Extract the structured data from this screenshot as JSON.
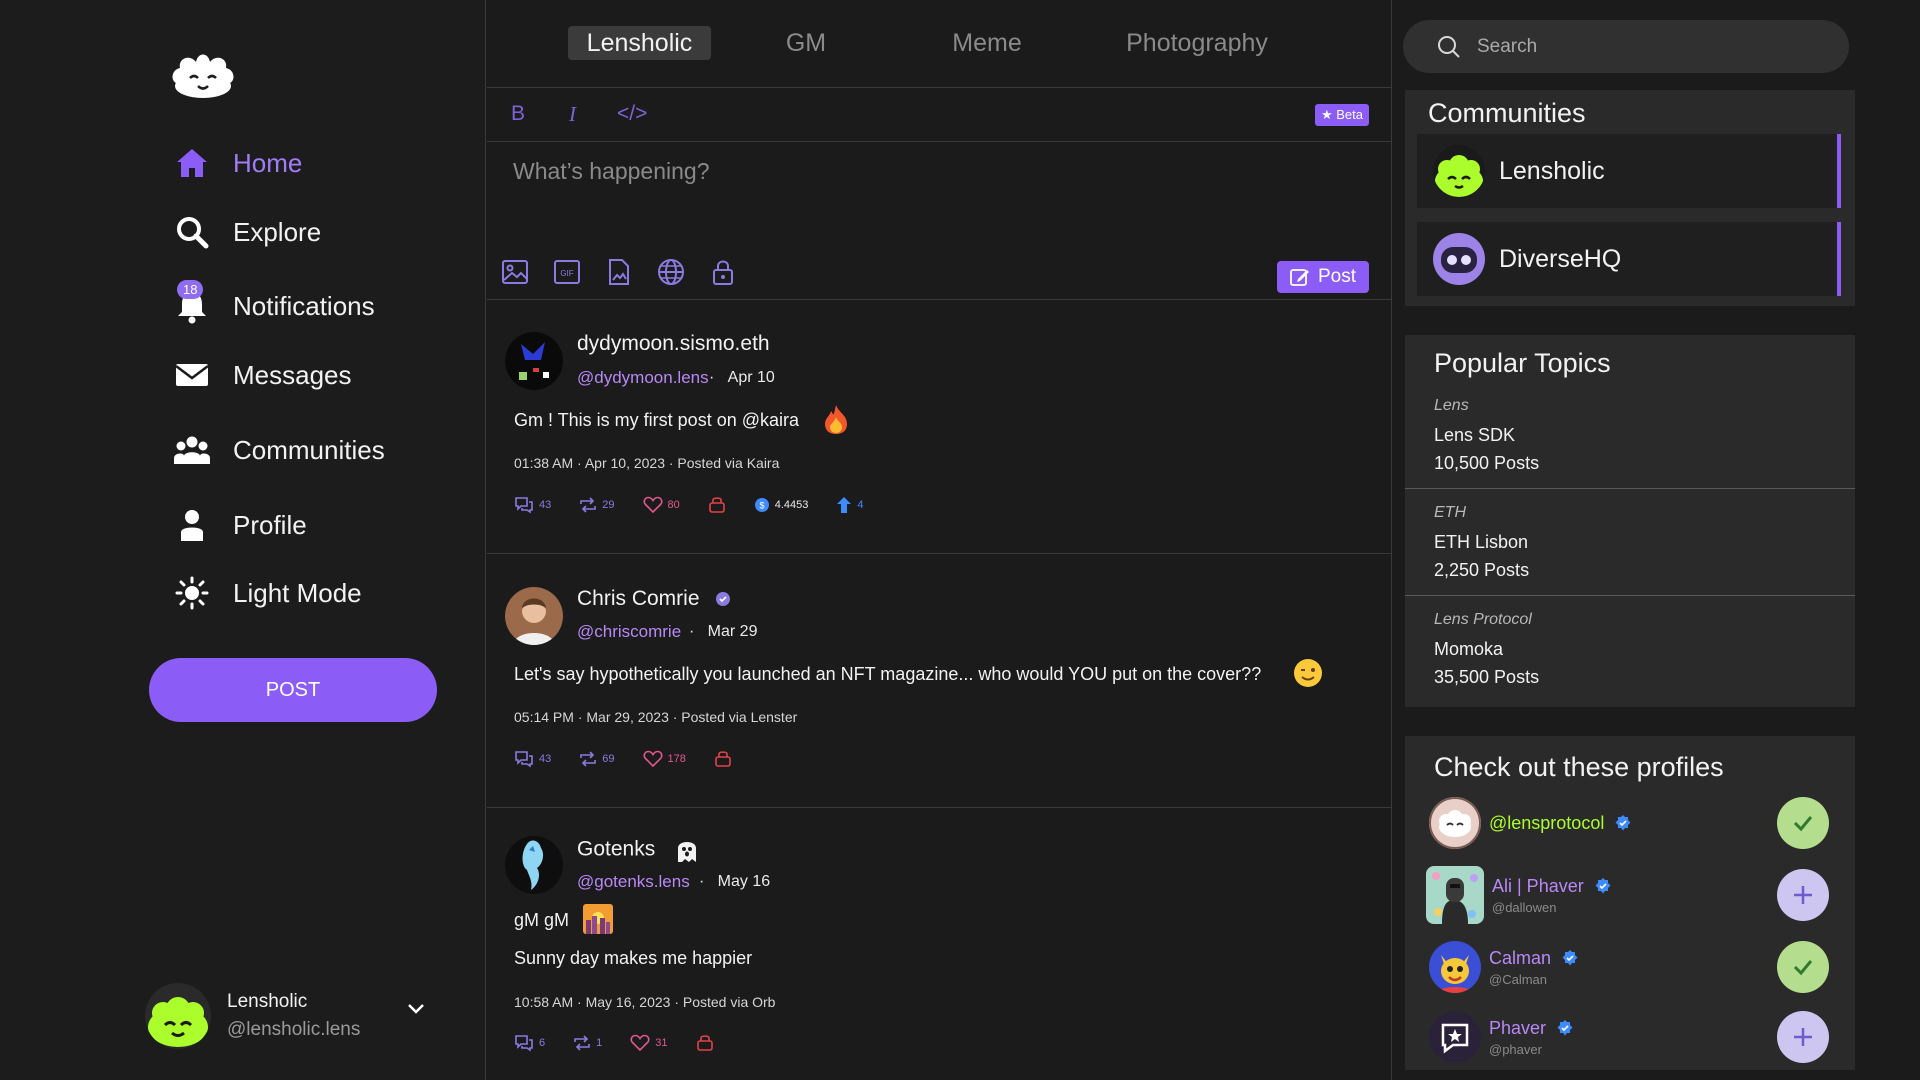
{
  "sidebar": {
    "items": [
      {
        "label": "Home",
        "icon": "home-icon"
      },
      {
        "label": "Explore",
        "icon": "search-icon"
      },
      {
        "label": "Notifications",
        "icon": "bell-icon",
        "badge": "18"
      },
      {
        "label": "Messages",
        "icon": "mail-icon"
      },
      {
        "label": "Communities",
        "icon": "people-icon"
      },
      {
        "label": "Profile",
        "icon": "user-icon"
      },
      {
        "label": "Light Mode",
        "icon": "sun-icon"
      }
    ],
    "post_button": "POST",
    "user": {
      "name": "Lensholic",
      "handle": "@lensholic.lens"
    }
  },
  "tabs": [
    "Lensholic",
    "GM",
    "Meme",
    "Photography"
  ],
  "editor": {
    "bold": "B",
    "italic": "I",
    "code": "</>",
    "beta": "Beta",
    "placeholder": "What’s happening?",
    "post_button": "Post"
  },
  "posts": [
    {
      "name": "dydymoon.sismo.eth",
      "handle": "@dydymoon.lens",
      "date": "Apr 10",
      "text": "Gm ! This is my first post on @kaira",
      "meta": "01:38 AM · Apr 10, 2023 · Posted via Kaira",
      "comments": "43",
      "mirrors": "29",
      "likes": "80",
      "collect_value": "4.4453",
      "upvotes": "4"
    },
    {
      "name": "Chris Comrie",
      "handle": "@chriscomrie",
      "date": "Mar 29",
      "text": "Let's say hypothetically you launched an NFT magazine... who would YOU put on the cover??",
      "meta": "05:14 PM · Mar 29, 2023 · Posted via Lenster",
      "comments": "43",
      "mirrors": "69",
      "likes": "178"
    },
    {
      "name": "Gotenks",
      "handle": "@gotenks.lens",
      "date": "May 16",
      "text": "gM gM",
      "text2": "Sunny day makes me happier",
      "meta": "10:58 AM · May 16, 2023 · Posted via Orb",
      "comments": "6",
      "mirrors": "1",
      "likes": "31"
    }
  ],
  "search": {
    "placeholder": "Search"
  },
  "communities": {
    "title": "Communities",
    "items": [
      "Lensholic",
      "DiverseHQ"
    ]
  },
  "topics": {
    "title": "Popular Topics",
    "items": [
      {
        "category": "Lens",
        "name": "Lens SDK",
        "count": "10,500 Posts"
      },
      {
        "category": "ETH",
        "name": "ETH Lisbon",
        "count": "2,250 Posts"
      },
      {
        "category": "Lens Protocol",
        "name": "Momoka",
        "count": "35,500 Posts"
      }
    ]
  },
  "profiles": {
    "title": "Check out these profiles",
    "items": [
      {
        "name": "@lensprotocol",
        "handle": "",
        "followed": true
      },
      {
        "name": "Ali | Phaver",
        "handle": "@dallowen",
        "followed": false
      },
      {
        "name": "Calman",
        "handle": "@Calman",
        "followed": true
      },
      {
        "name": "Phaver",
        "handle": "@phaver",
        "followed": false
      }
    ]
  },
  "colors": {
    "accent": "#8b5cf6",
    "handle": "#b888f5",
    "lens_green": "#abfe2c",
    "verified": "#3d8bfd"
  }
}
